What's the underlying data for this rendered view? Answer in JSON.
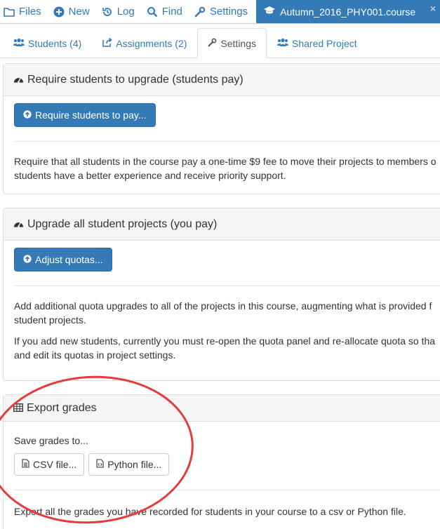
{
  "topnav": {
    "items": [
      {
        "label": "Files",
        "icon": "folder-icon"
      },
      {
        "label": "New",
        "icon": "plus-circle-icon"
      },
      {
        "label": "Log",
        "icon": "history-icon"
      },
      {
        "label": "Find",
        "icon": "search-icon"
      },
      {
        "label": "Settings",
        "icon": "wrench-icon"
      }
    ],
    "active_file": "Autumn_2016_PHY001.course",
    "active_icon": "graduation-cap-icon",
    "close_label": "×"
  },
  "tabs": [
    {
      "label": "Students (4)",
      "icon": "users-icon"
    },
    {
      "label": "Assignments (2)",
      "icon": "share-icon"
    },
    {
      "label": "Settings",
      "icon": "wrench-icon"
    },
    {
      "label": "Shared Project",
      "icon": "users-icon"
    }
  ],
  "panels": {
    "require": {
      "title": "Require students to upgrade (students pay)",
      "button": "Require students to pay...",
      "text_line1": "Require that all students in the course pay a one-time $9 fee to move their projects to members o",
      "text_line2": "students have a better experience and receive priority support."
    },
    "upgrade": {
      "title": "Upgrade all student projects (you pay)",
      "button": "Adjust quotas...",
      "text_line1": "Add additional quota upgrades to all of the projects in this course, augmenting what is provided f",
      "text_line2": "student projects.",
      "text_line3": "If you add new students, currently you must re-open the quota panel and re-allocate quota so tha",
      "text_line4": "and edit its quotas in project settings."
    },
    "export": {
      "title": "Export grades",
      "save_to": "Save grades to...",
      "csv_button": "CSV file...",
      "python_button": "Python file...",
      "text_line1": "Export all the grades you have recorded for students in your course to a csv or Python file."
    }
  },
  "colors": {
    "accent": "#337ab7",
    "annotation": "#e63b3b"
  }
}
